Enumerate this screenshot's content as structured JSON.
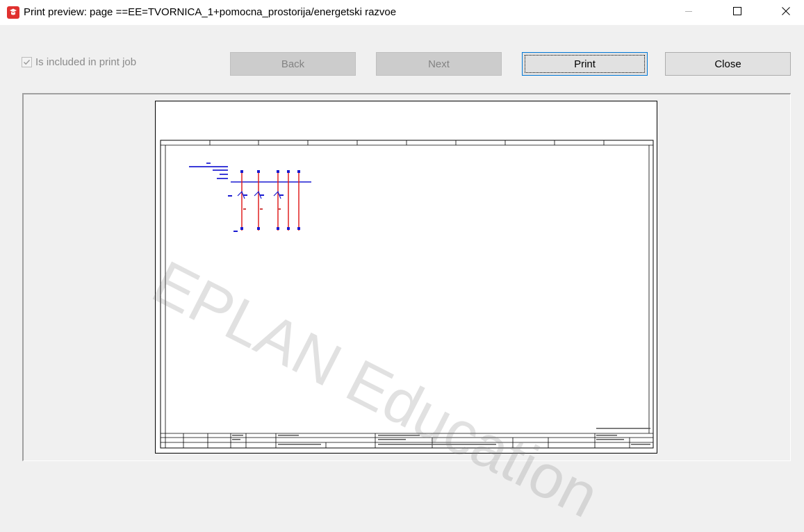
{
  "window": {
    "title": "Print preview: page ==EE=TVORNICA_1+pomocna_prostorija/energetski razvoe",
    "icon": "eplan-logo-icon",
    "controls": [
      "minimize-icon",
      "maximize-icon",
      "close-icon"
    ]
  },
  "toolbar": {
    "checkbox_label": "Is included in print job",
    "checkbox_checked": true,
    "back_label": "Back",
    "next_label": "Next",
    "print_label": "Print",
    "close_label": "Close"
  },
  "preview": {
    "watermark": "EPLAN Education"
  },
  "colors": {
    "accent": "#0078d7",
    "icon_red": "#e0312f",
    "schematic_red": "#e02020",
    "schematic_blue": "#1a1ad0"
  }
}
